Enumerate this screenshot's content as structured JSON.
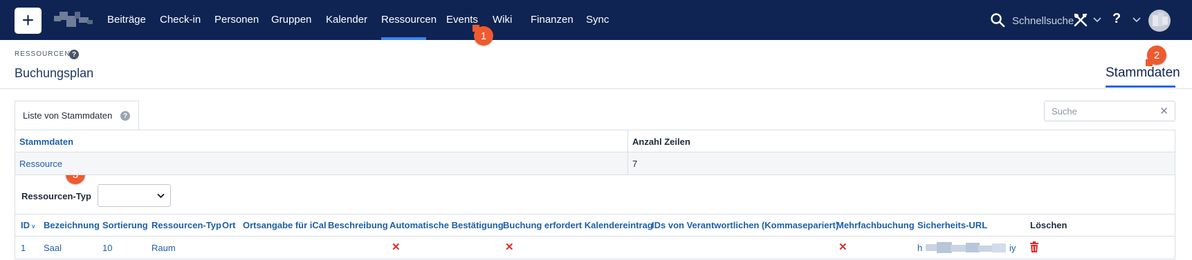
{
  "nav": {
    "add_label": "+",
    "items": [
      "Beiträge",
      "Check-in",
      "Personen",
      "Gruppen",
      "Kalender",
      "Ressourcen",
      "Events",
      "Wiki",
      "Finanzen",
      "Sync"
    ],
    "active": "Ressourcen",
    "quick_search": "Schnellsuche",
    "help": "?"
  },
  "badges": [
    "1",
    "2",
    "3"
  ],
  "header": {
    "breadcrumb": "RESSOURCEN",
    "help": "?",
    "title": "Buchungsplan",
    "right_tab": "Stammdaten"
  },
  "panel": {
    "tab_label": "Liste von Stammdaten",
    "help": "?",
    "search_placeholder": "Suche",
    "clear": "✕"
  },
  "overview_table": {
    "columns": [
      "Stammdaten",
      "Anzahl Zeilen"
    ],
    "rows": [
      {
        "name": "Ressource",
        "count": "7"
      }
    ]
  },
  "filter": {
    "label": "Ressourcen-Typ",
    "selected": ""
  },
  "resource_table": {
    "columns": [
      "ID",
      "Bezeichnung",
      "Sortierung",
      "Ressourcen-Typ",
      "Ort",
      "Ortsangabe für iCal",
      "Beschreibung",
      "Automatische Bestätigung",
      "Buchung erfordert Kalendereintrag",
      "IDs von Verantwortlichen (Kommasepariert)",
      "Mehrfachbuchung",
      "Sicherheits-URL",
      "Löschen"
    ],
    "sort_indicator": "∨",
    "rows": [
      {
        "id": "1",
        "bezeichnung": "Saal",
        "sortierung": "10",
        "typ": "Raum",
        "auto_bestaetigung": "✕",
        "kalendereintrag": "✕",
        "mehrfachbuchung": "✕",
        "url_start": "h",
        "url_end": "iy"
      }
    ]
  },
  "colors": {
    "navbar": "#0f2453",
    "link": "#1d5fa8",
    "badge": "#ef5a2f",
    "active_underline": "#2563eb",
    "danger": "#e02a2a"
  }
}
